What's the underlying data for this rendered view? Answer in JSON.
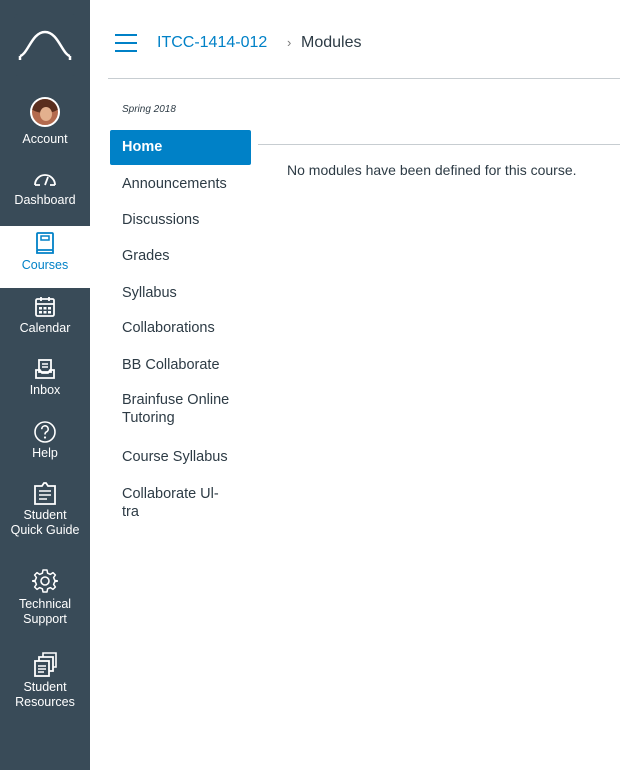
{
  "global_nav": {
    "items": [
      {
        "label": "Account",
        "icon": "avatar"
      },
      {
        "label": "Dashboard",
        "icon": "dashboard-icon"
      },
      {
        "label": "Courses",
        "icon": "courses-icon",
        "active": true
      },
      {
        "label": "Calendar",
        "icon": "calendar-icon"
      },
      {
        "label": "Inbox",
        "icon": "inbox-icon"
      },
      {
        "label": "Help",
        "icon": "help-icon"
      },
      {
        "label_line1": "Student",
        "label_line2": "Quick Guide",
        "icon": "quick-guide-icon"
      },
      {
        "label_line1": "Technical",
        "label_line2": "Support",
        "icon": "gear-icon"
      },
      {
        "label_line1": "Student",
        "label_line2": "Resources",
        "icon": "resources-icon"
      }
    ]
  },
  "header": {
    "course_code": "ITCC-1414-012",
    "separator": "›",
    "current_page": "Modules"
  },
  "course_nav": {
    "term": "Spring 2018",
    "items": [
      {
        "label": "Home",
        "active": true
      },
      {
        "label": "Announcements"
      },
      {
        "label": "Discussions"
      },
      {
        "label": "Grades"
      },
      {
        "label": "Syllabus"
      },
      {
        "label": "Collaborations"
      },
      {
        "label": "BB Collaborate"
      },
      {
        "label_line1": "Brainfuse Online",
        "label_line2": "Tutoring"
      },
      {
        "label": "Course Syllabus"
      },
      {
        "label_line1": "Collaborate Ul-",
        "label_line2": "tra"
      }
    ]
  },
  "content": {
    "empty_message": "No modules have been defined for this course."
  },
  "colors": {
    "nav_bg": "#394b58",
    "accent": "#0081c7",
    "text": "#2d3b45",
    "rule": "#c7cdd1"
  }
}
